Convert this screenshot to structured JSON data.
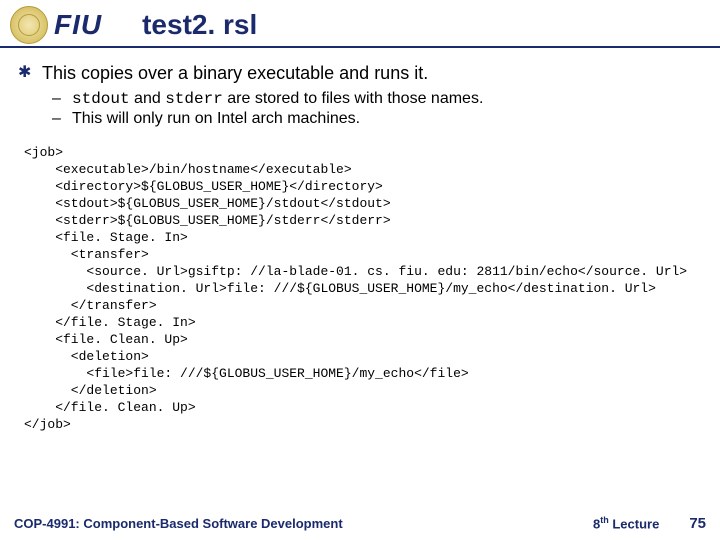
{
  "header": {
    "logo_text": "FIU",
    "title": "test2. rsl"
  },
  "bullets": {
    "main": "This copies over a binary executable and runs it.",
    "sub1_pre": "stdout",
    "sub1_mid": " and ",
    "sub1_mid2": "stderr",
    "sub1_post": " are stored to files with those names.",
    "sub2": "This will only run on Intel arch machines."
  },
  "code": "<job>\n    <executable>/bin/hostname</executable>\n    <directory>${GLOBUS_USER_HOME}</directory>\n    <stdout>${GLOBUS_USER_HOME}/stdout</stdout>\n    <stderr>${GLOBUS_USER_HOME}/stderr</stderr>\n    <file. Stage. In>\n      <transfer>\n        <source. Url>gsiftp: //la-blade-01. cs. fiu. edu: 2811/bin/echo</source. Url>\n        <destination. Url>file: ///${GLOBUS_USER_HOME}/my_echo</destination. Url>\n      </transfer>\n    </file. Stage. In>\n    <file. Clean. Up>\n      <deletion>\n        <file>file: ///${GLOBUS_USER_HOME}/my_echo</file>\n      </deletion>\n    </file. Clean. Up>\n</job>",
  "footer": {
    "left": "COP-4991: Component-Based Software Development",
    "mid_num": "8",
    "mid_sup": "th",
    "mid_post": " Lecture",
    "page": "75"
  }
}
